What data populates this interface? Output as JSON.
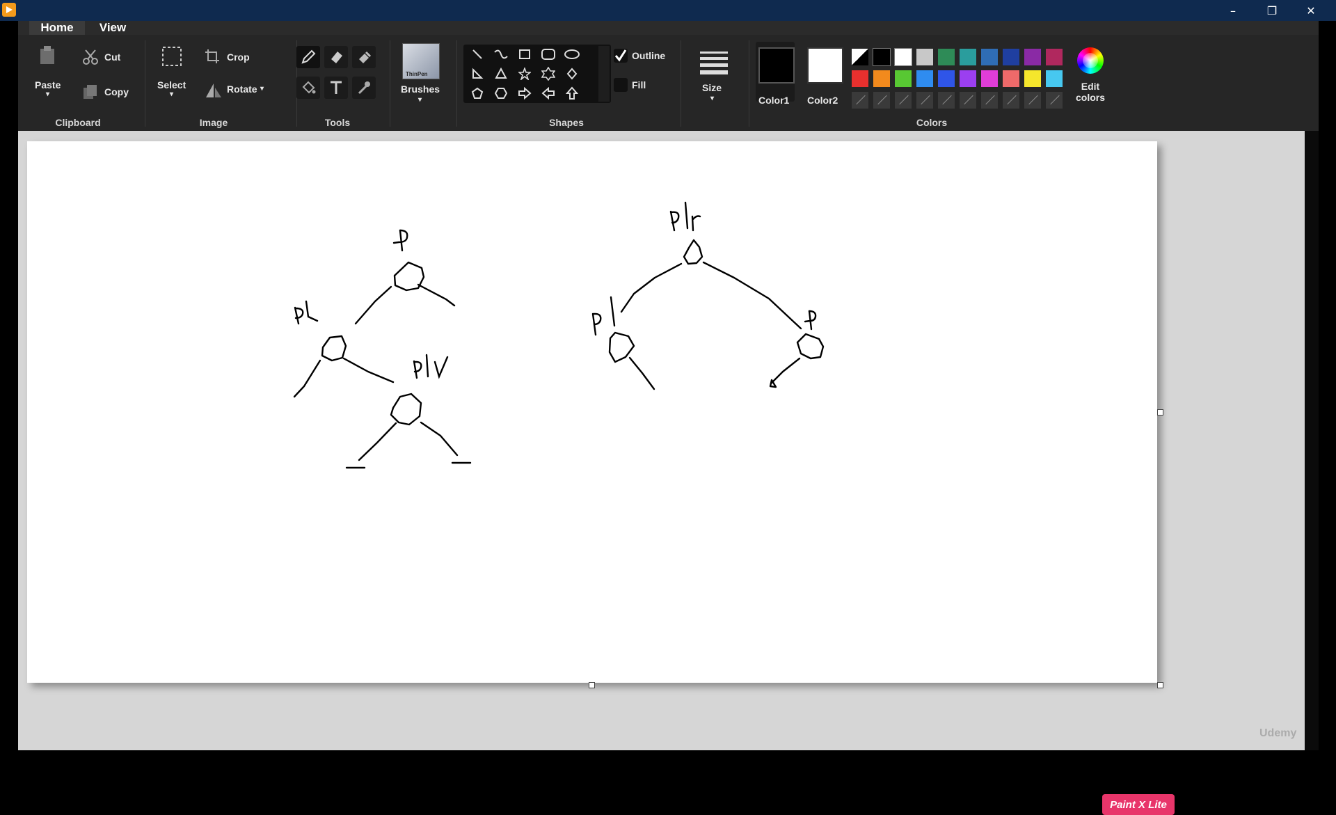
{
  "menu": {
    "tabs": [
      "Home",
      "View"
    ]
  },
  "ribbon": {
    "clipboard": {
      "label": "Clipboard",
      "paste": "Paste",
      "cut": "Cut",
      "copy": "Copy"
    },
    "image": {
      "label": "Image",
      "select": "Select",
      "crop": "Crop",
      "rotate": "Rotate"
    },
    "tools": {
      "label": "Tools"
    },
    "brushes": {
      "label": "Brushes",
      "thumb_text": "ThinPen"
    },
    "shapes": {
      "label": "Shapes",
      "outline": "Outline",
      "fill": "Fill",
      "outline_checked": true,
      "fill_checked": false
    },
    "size": {
      "label": "Size"
    },
    "colors": {
      "label": "Colors",
      "color1": "Color1",
      "color2": "Color2",
      "color1_value": "#000000",
      "color2_value": "#ffffff",
      "edit": "Edit colors",
      "palette_row1": [
        "#000000",
        "#000000",
        "#ffffff",
        "#c8c8c8",
        "#2e8b57",
        "#2a9d9d",
        "#2f6db5",
        "#1f3fa0",
        "#8a2aa5",
        "#b0285e"
      ],
      "palette_row2": [
        "#e8302e",
        "#f28a1d",
        "#58c833",
        "#2f8cf0",
        "#2f55e8",
        "#9b3ff0",
        "#e03dd8",
        "#ee6a6a",
        "#f5e62c",
        "#47c8f0"
      ]
    }
  },
  "canvas": {
    "annotations": [
      "P",
      "Pl",
      "Plr",
      "Pl",
      "Plr",
      "P"
    ]
  },
  "badge": "Paint X Lite",
  "watermark": "Udemy"
}
